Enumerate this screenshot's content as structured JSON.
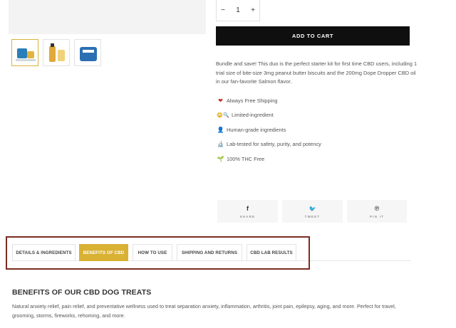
{
  "quantity": {
    "minus": "−",
    "value": "1",
    "plus": "+"
  },
  "add_to_cart": "ADD TO CART",
  "description": "Bundle and save! This duo is the perfect starter kit for first time CBD users, including 1 trial size of bite-size 3mg peanut butter biscuits and the 200mg Dope Dropper CBD oil in our fan-favorite Salmon flavor.",
  "features": [
    {
      "icon": "heart-icon",
      "glyph": "❤",
      "color": "#c0392b",
      "label": "Always Free Shipping"
    },
    {
      "icon": "face-magnifier-icon",
      "glyph": "😳🔍",
      "color": "#333333",
      "label": "Limited-ingredient"
    },
    {
      "icon": "person-icon",
      "glyph": "👤",
      "color": "#8a5a2b",
      "label": "Human-grade ingredients"
    },
    {
      "icon": "microscope-icon",
      "glyph": "🔬",
      "color": "#555555",
      "label": "Lab-tested for safety, purity, and potency"
    },
    {
      "icon": "leaf-icon",
      "glyph": "🌱",
      "color": "#5a8a2b",
      "label": "100% THC Free"
    }
  ],
  "share": [
    {
      "icon": "facebook-icon",
      "glyph": "f",
      "label": "SHARE"
    },
    {
      "icon": "twitter-icon",
      "glyph": "🐦",
      "label": "TWEET"
    },
    {
      "icon": "pinterest-icon",
      "glyph": "℗",
      "label": "PIN IT"
    }
  ],
  "tabs": [
    {
      "label": "DETAILS & INGREDIENTS",
      "active": false
    },
    {
      "label": "BENEFITS OF CBD",
      "active": true
    },
    {
      "label": "HOW TO USE",
      "active": false
    },
    {
      "label": "SHIPPING AND RETURNS",
      "active": false
    },
    {
      "label": "CBD LAB RESULTS",
      "active": false
    }
  ],
  "section": {
    "title": "BENEFITS OF OUR CBD DOG TREATS",
    "body": "Natural anxiety relief, pain relief, and preventative wellness used to treat separation anxiety, inflammation, arthritis, joint pain, epilepsy, aging, and more. Perfect for travel, grooming, storms, fireworks, rehoming, and more."
  },
  "colors": {
    "accent": "#d9b133",
    "highlight_border": "#7b2c22",
    "button": "#0f0f0f"
  }
}
